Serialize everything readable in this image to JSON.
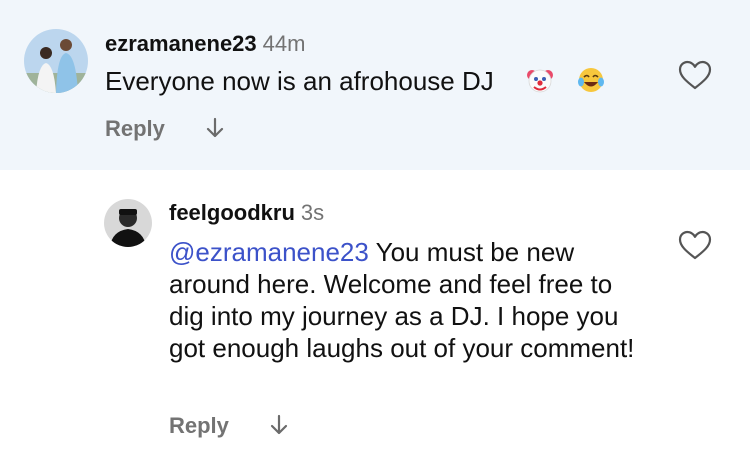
{
  "comments": [
    {
      "username": "ezramanene23",
      "time": "44m",
      "text": "Everyone  now is an afrohouse DJ",
      "emojis": [
        "clown-face-emoji",
        "face-with-tears-of-joy-emoji"
      ],
      "reply_label": "Reply",
      "highlight_bg": "#f1f6fb"
    },
    {
      "username": "feelgoodkru",
      "time": "3s",
      "mention": "@ezramanene23",
      "text": " You must be new around here. Welcome and feel free to dig into my journey as a DJ. I hope you got enough laughs out of your comment!",
      "reply_label": "Reply"
    }
  ],
  "colors": {
    "mention": "#3c52c9",
    "secondary_text": "#737373"
  }
}
